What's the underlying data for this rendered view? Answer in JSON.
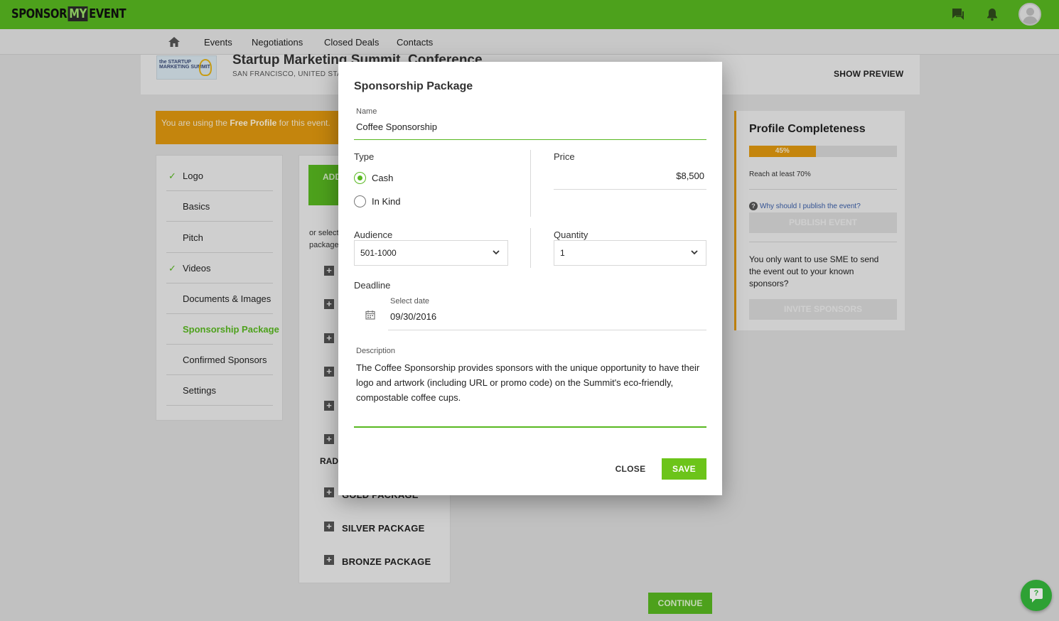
{
  "app": {
    "logo_left": "SPONSOR",
    "logo_mid": "MY",
    "logo_right": "EVENT",
    "icons": [
      "chat-icon",
      "bell-icon",
      "avatar"
    ]
  },
  "nav": {
    "home_icon": "home-icon",
    "items": [
      {
        "label": "Events"
      },
      {
        "label": "Negotiations"
      },
      {
        "label": "Closed Deals"
      },
      {
        "label": "Contacts"
      }
    ]
  },
  "event": {
    "thumb_text": "the STARTUP MARKETING SUMMIT",
    "title": "Startup Marketing Summit, Conference",
    "location": "SAN FRANCISCO, UNITED STAT",
    "show_preview": "SHOW PREVIEW"
  },
  "notice": {
    "prefix": "You are using the ",
    "bold": "Free Profile",
    "suffix": " for this event."
  },
  "sidebar": {
    "items": [
      {
        "label": "Logo",
        "check": "✓"
      },
      {
        "label": "Basics",
        "check": ""
      },
      {
        "label": "Pitch",
        "check": ""
      },
      {
        "label": "Videos",
        "check": "✓"
      },
      {
        "label": "Documents & Images",
        "check": ""
      },
      {
        "label": "Sponsorship Package",
        "check": ""
      },
      {
        "label": "Confirmed Sponsors",
        "check": ""
      },
      {
        "label": "Settings",
        "check": ""
      }
    ]
  },
  "packages": {
    "add_button": "ADD",
    "or_select_1": "or select",
    "or_select_2": "package",
    "radio_label": "RADI",
    "list": [
      {
        "label": "GOLD PACKAGE"
      },
      {
        "label": "SILVER PACKAGE"
      },
      {
        "label": "BRONZE PACKAGE"
      }
    ]
  },
  "profile": {
    "title": "Profile Completeness",
    "progress_percent": 45,
    "progress_label": "45%",
    "reach": "Reach at least 70%",
    "why_link": "Why should I publish the event?",
    "publish_button": "PUBLISH EVENT",
    "sme_text": "You only want to use SME to send the event out to your known sponsors?",
    "invite_button": "INVITE SPONSORS"
  },
  "continue_button": "CONTINUE",
  "modal": {
    "title": "Sponsorship Package",
    "name": {
      "label": "Name",
      "value": "Coffee Sponsorship"
    },
    "type": {
      "label": "Type",
      "options": [
        {
          "label": "Cash",
          "checked": true
        },
        {
          "label": "In Kind",
          "checked": false
        }
      ]
    },
    "price": {
      "label": "Price",
      "value": "$8,500"
    },
    "audience": {
      "label": "Audience",
      "value": "501-1000"
    },
    "quantity": {
      "label": "Quantity",
      "value": "1"
    },
    "deadline": {
      "label": "Deadline",
      "sublabel": "Select date",
      "value": "09/30/2016"
    },
    "description": {
      "label": "Description",
      "value": "The Coffee Sponsorship provides sponsors with the unique opportunity to have their logo and artwork (including URL or promo code) on the Summit's eco-friendly, compostable coffee cups."
    },
    "close_button": "CLOSE",
    "save_button": "SAVE"
  },
  "colors": {
    "brand_green": "#58b820",
    "accent_orange": "#e0980f",
    "save_green": "#6cc41a"
  }
}
